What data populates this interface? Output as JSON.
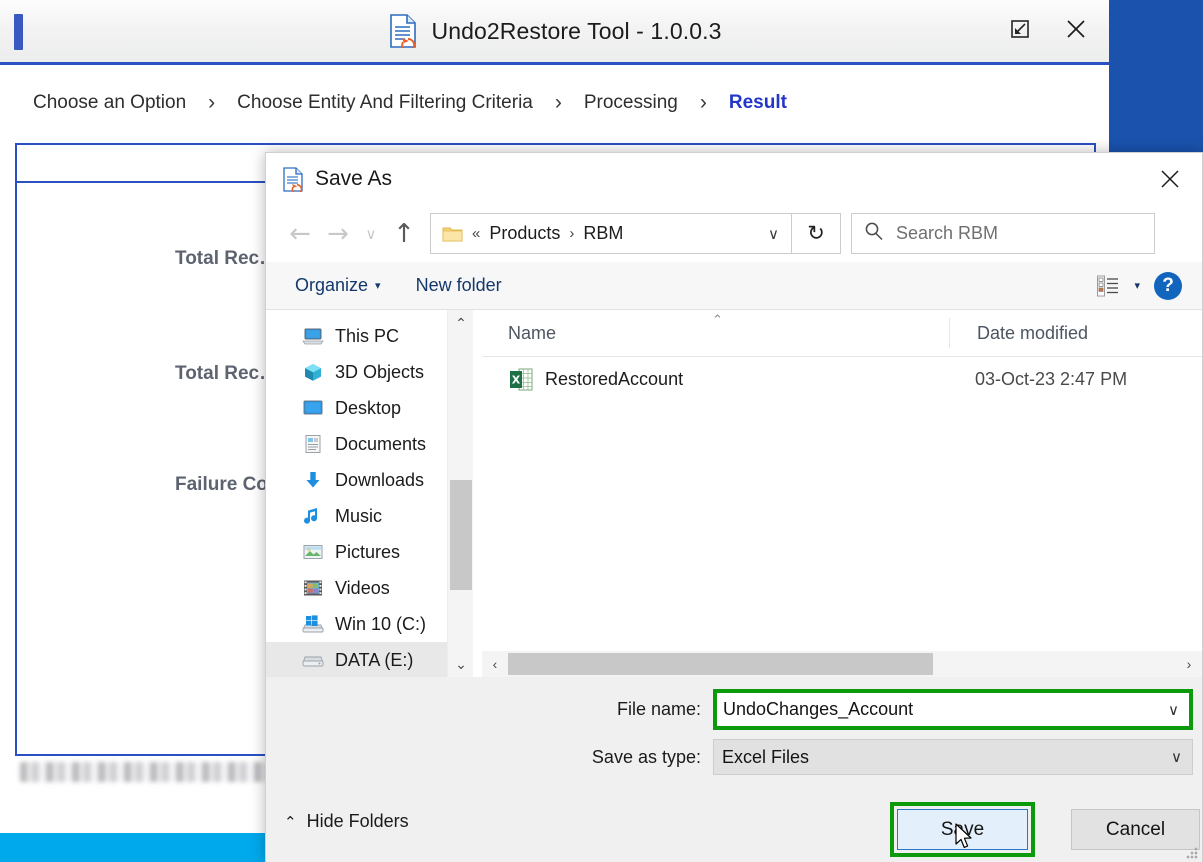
{
  "app": {
    "title": "Undo2Restore Tool - 1.0.0.3",
    "restore_label": "Restore Down",
    "close_label": "Close",
    "wizard": {
      "steps": [
        {
          "label": "Choose an Option",
          "active": false
        },
        {
          "label": "Choose Entity And Filtering Criteria",
          "active": false
        },
        {
          "label": "Processing",
          "active": false
        },
        {
          "label": "Result",
          "active": true
        }
      ],
      "separator": "›"
    },
    "result_labels": [
      "Total Rec…",
      "Total Rec…",
      "Failure Co…"
    ],
    "accent_color": "#2336c7",
    "bottom_bar_color": "#00a8ec"
  },
  "dialog": {
    "title": "Save As",
    "close_label": "✕",
    "address": {
      "back_label": "←",
      "forward_label": "→",
      "recent_label": "∨",
      "up_label": "↑",
      "prefix": "«",
      "crumbs": [
        "Products",
        "RBM"
      ],
      "crumb_sep": "›",
      "dropdown_label": "∨",
      "refresh_label": "↻"
    },
    "search": {
      "placeholder": "Search RBM"
    },
    "commands": {
      "organize": "Organize",
      "organize_caret": "▾",
      "new_folder": "New folder",
      "view_caret": "▾",
      "help": "?"
    },
    "nav_items": [
      {
        "label": "This PC",
        "icon": "pc-icon",
        "selected": false
      },
      {
        "label": "3D Objects",
        "icon": "3d-objects-icon",
        "selected": false
      },
      {
        "label": "Desktop",
        "icon": "desktop-icon",
        "selected": false
      },
      {
        "label": "Documents",
        "icon": "documents-icon",
        "selected": false
      },
      {
        "label": "Downloads",
        "icon": "downloads-icon",
        "selected": false
      },
      {
        "label": "Music",
        "icon": "music-icon",
        "selected": false
      },
      {
        "label": "Pictures",
        "icon": "pictures-icon",
        "selected": false
      },
      {
        "label": "Videos",
        "icon": "videos-icon",
        "selected": false
      },
      {
        "label": "Win 10 (C:)",
        "icon": "drive-icon",
        "selected": false
      },
      {
        "label": "DATA (E:)",
        "icon": "drive-icon",
        "selected": true
      }
    ],
    "columns": {
      "name": "Name",
      "date_modified": "Date modified",
      "sort_mark": "⌃"
    },
    "files": [
      {
        "name": "RestoredAccount",
        "date_modified": "03-Oct-23 2:47 PM",
        "icon": "excel-file-icon"
      }
    ],
    "form": {
      "file_name_label": "File name:",
      "file_name_value": "UndoChanges_Account",
      "file_name_placeholder": "",
      "save_as_type_label": "Save as type:",
      "save_as_type_value": "Excel Files",
      "combo_caret": "∨"
    },
    "hide_folders": {
      "caret": "⌃",
      "label": "Hide Folders"
    },
    "buttons": {
      "save": "Save",
      "cancel": "Cancel"
    },
    "scroll": {
      "up": "⌃",
      "down": "⌄",
      "left": "‹",
      "right": "›"
    },
    "highlight_color": "#0b9a0b"
  }
}
